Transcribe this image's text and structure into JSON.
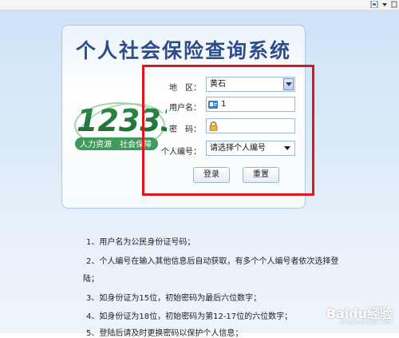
{
  "page": {
    "title": "个人社会保险查询系统"
  },
  "logo": {
    "number": "12333",
    "slogan_left": "人力资源",
    "slogan_right": "社会保障"
  },
  "form": {
    "region_label": "地　区：",
    "region_value": "黄石",
    "username_label": "用户名：",
    "username_value": "1",
    "password_label": "密　码：",
    "person_no_label": "个人编号：",
    "person_no_value": "请选择个人编号",
    "login_label": "登录",
    "reset_label": "重置"
  },
  "notes": [
    "1、用户名为公民身份证号码；",
    "2、个人编号在输入其他信息后自动获取，有多个个人编号者依次选择登",
    "陆；",
    "3、如身份证为15位，初始密码为最后六位数字；",
    "4、如身份证为18位，初始密码为第12-17位的六位数字；",
    "5、登陆后请及时更换密码以保护个人信息；"
  ],
  "watermark": {
    "text": "Baidu经验",
    "sub": "jingyan.baidu.com"
  },
  "colors": {
    "title": "#2c4c8c",
    "highlight": "#e0161b",
    "background": "#dbeaf8"
  }
}
